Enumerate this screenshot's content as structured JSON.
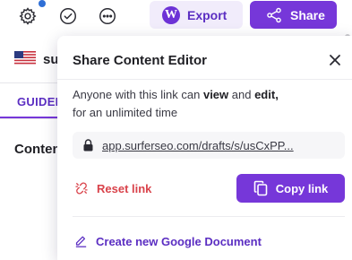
{
  "toolbar": {
    "icons": [
      "gear-icon",
      "check-circle-icon",
      "more-options-icon"
    ],
    "export_label": "Export",
    "share_label": "Share"
  },
  "sidebar": {
    "language_text": "su",
    "guide_tab": "GUIDEL",
    "content_label": "Conten"
  },
  "share_dialog": {
    "title": "Share Content Editor",
    "description_prefix": "Anyone with this link can ",
    "permission_view": "view",
    "description_and": " and ",
    "permission_edit": "edit,",
    "description_suffix": "for an unlimited time",
    "link_url": "app.surferseo.com/drafts/s/usCxPP...",
    "reset_label": "Reset link",
    "copy_label": "Copy link",
    "gdoc_label": "Create new Google Document"
  },
  "colors": {
    "accent": "#7637d9",
    "accent_text": "#5b2ec2",
    "danger": "#d9434b",
    "notification": "#2f6fd6"
  }
}
